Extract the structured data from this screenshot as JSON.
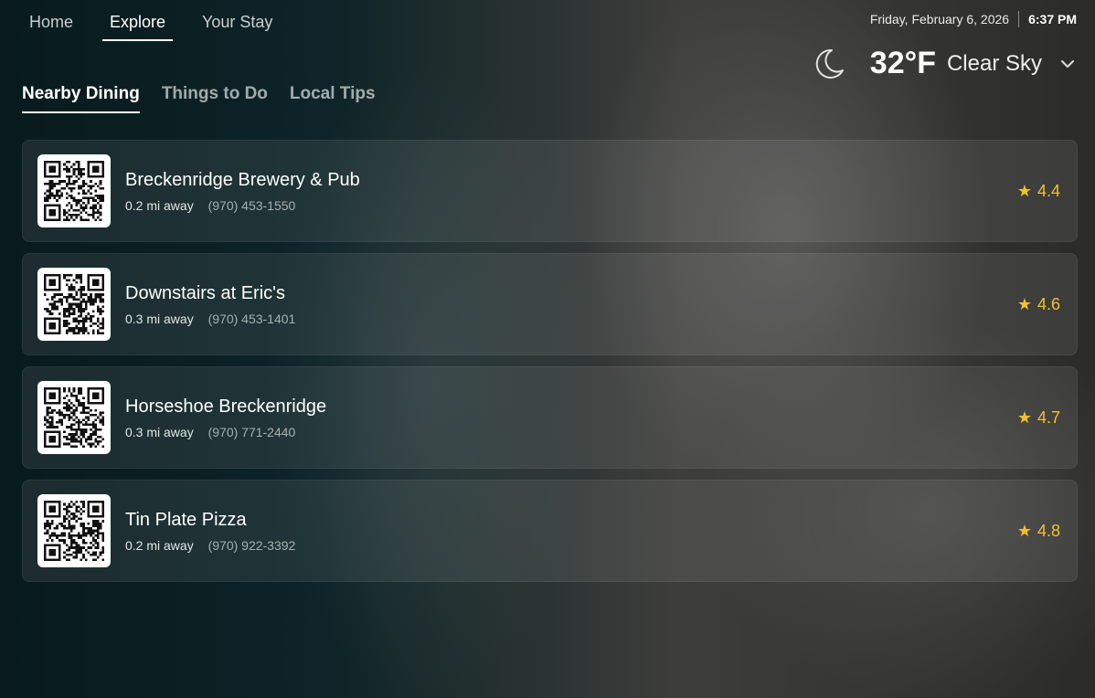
{
  "nav": {
    "items": [
      {
        "label": "Home"
      },
      {
        "label": "Explore"
      },
      {
        "label": "Your Stay"
      }
    ],
    "active_index": 1
  },
  "header": {
    "date": "Friday, February 6, 2026",
    "time": "6:37 PM"
  },
  "weather": {
    "icon": "moon-icon",
    "temperature": "32°F",
    "condition": "Clear Sky"
  },
  "tabs": {
    "items": [
      {
        "label": "Nearby Dining"
      },
      {
        "label": "Things to Do"
      },
      {
        "label": "Local Tips"
      }
    ],
    "active_index": 0
  },
  "restaurants": [
    {
      "name": "Breckenridge Brewery & Pub",
      "distance": "0.2 mi away",
      "phone": "(970) 453-1550",
      "rating": "4.4"
    },
    {
      "name": "Downstairs at Eric's",
      "distance": "0.3 mi away",
      "phone": "(970) 453-1401",
      "rating": "4.6"
    },
    {
      "name": "Horseshoe Breckenridge",
      "distance": "0.3 mi away",
      "phone": "(970) 771-2440",
      "rating": "4.7"
    },
    {
      "name": "Tin Plate Pizza",
      "distance": "0.2 mi away",
      "phone": "(970) 922-3392",
      "rating": "4.8"
    }
  ],
  "colors": {
    "rating_star": "#f2c12e",
    "card_background": "rgba(255,255,255,0.08)"
  }
}
